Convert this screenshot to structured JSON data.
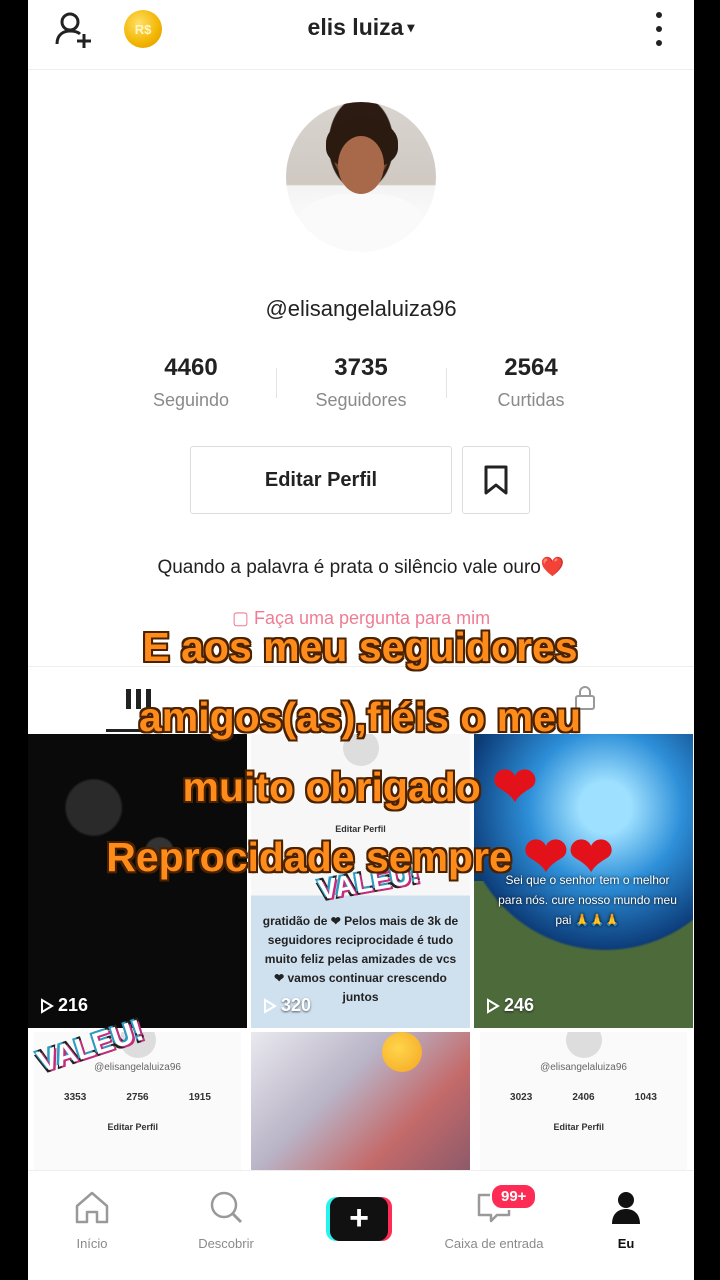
{
  "header": {
    "title": "elis luiza",
    "caret": "▾",
    "coin_label": "R$"
  },
  "profile": {
    "username": "@elisangelaluiza96",
    "stats": [
      {
        "value": "4460",
        "label": "Seguindo"
      },
      {
        "value": "3735",
        "label": "Seguidores"
      },
      {
        "value": "2564",
        "label": "Curtidas"
      }
    ],
    "edit_label": "Editar Perfil",
    "bio": "Quando a palavra é prata o silêncio vale ouro",
    "bio_emoji": "❤️",
    "question_link": "Faça uma pergunta para mim"
  },
  "caption": {
    "line1": "E aos meu seguidores",
    "line2": "amigos(as),fiéis o meu",
    "line3": "muito obrigado",
    "line4": "Reprocidade sempre",
    "heart": "❤"
  },
  "videos": [
    {
      "views": "216"
    },
    {
      "views": "320"
    },
    {
      "views": "246"
    }
  ],
  "tile_texts": {
    "tile2_overlay": "gratidão de ❤ Pelos mais de 3k de seguidores reciprocidade é tudo muito feliz pelas amizades de vcs ❤ vamos continuar crescendo juntos",
    "tile3_overlay": "Sei que o senhor tem o melhor para nós. cure nosso mundo meu pai 🙏🙏🙏",
    "tile2_edit": "Editar Perfil",
    "valeu": "VALEU!",
    "mini1_stats": [
      "3353",
      "2756",
      "1915"
    ],
    "mini1_user": "@elisangelaluiza96",
    "mini1_edit": "Editar Perfil",
    "mini3_user": "@elisangelaluiza96",
    "mini3_stats": [
      "3023",
      "2406",
      "1043"
    ],
    "mini3_edit": "Editar Perfil"
  },
  "bottom_nav": {
    "home": "Início",
    "discover": "Descobrir",
    "create": "+",
    "inbox": "Caixa de entrada",
    "inbox_badge": "99+",
    "me": "Eu"
  },
  "colors": {
    "caption_fill": "#ff8c1a",
    "accent_pink": "#fe2c55",
    "accent_cyan": "#25f4ee"
  }
}
